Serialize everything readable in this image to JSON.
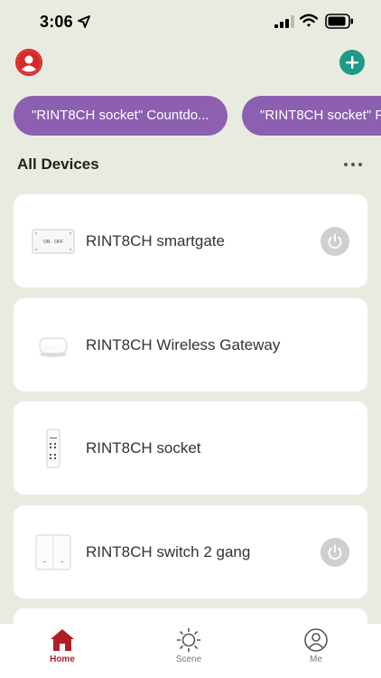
{
  "status": {
    "time": "3:06"
  },
  "scenes": [
    {
      "label": "\"RINT8CH socket\" Countdo..."
    },
    {
      "label": "\"RINT8CH socket\" P"
    }
  ],
  "section": {
    "title": "All Devices"
  },
  "devices": [
    {
      "name": "RINT8CH smartgate",
      "image_text": "ON · OFF",
      "has_power": true
    },
    {
      "name": "RINT8CH Wireless Gateway",
      "has_power": false
    },
    {
      "name": "RINT8CH socket",
      "has_power": false
    },
    {
      "name": "RINT8CH switch 2 gang",
      "has_power": true
    }
  ],
  "tabs": [
    {
      "label": "Home",
      "icon": "home-icon",
      "active": true
    },
    {
      "label": "Scene",
      "icon": "sun-icon",
      "active": false
    },
    {
      "label": "Me",
      "icon": "person-icon",
      "active": false
    }
  ],
  "colors": {
    "accent": "#b01e26",
    "scene_chip": "#8c5fb1",
    "add_button": "#1f9a85",
    "background": "#e9ebe1"
  }
}
